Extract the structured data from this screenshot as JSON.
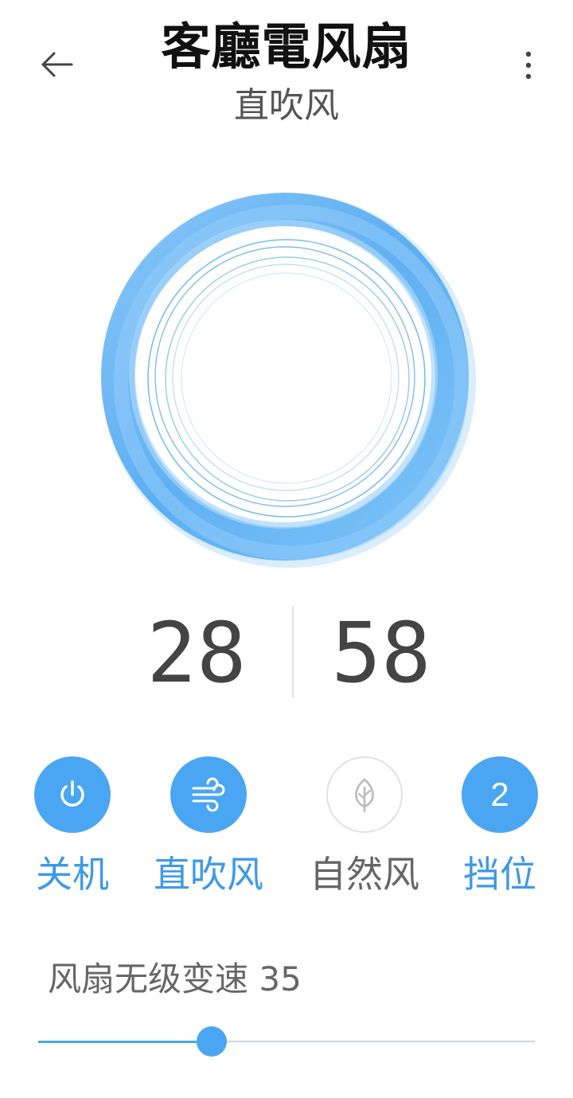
{
  "header": {
    "title": "客廳電风扇",
    "subtitle": "直吹风"
  },
  "readouts": {
    "left_value": "28",
    "right_value": "58"
  },
  "controls": [
    {
      "icon": "power-icon",
      "label": "关机",
      "active": true
    },
    {
      "icon": "wind-icon",
      "label": "直吹风",
      "active": true
    },
    {
      "icon": "leaf-icon",
      "label": "自然风",
      "active": false
    },
    {
      "icon": "number-badge",
      "badge": "2",
      "label": "挡位",
      "active": true
    }
  ],
  "speed": {
    "label_text": "风扇无级变速 35",
    "value": 35
  },
  "colors": {
    "accent": "#4aa6f2",
    "ring_light": "#a9d5fb",
    "label_active": "#3d9ae8",
    "text_grey": "#666666"
  }
}
